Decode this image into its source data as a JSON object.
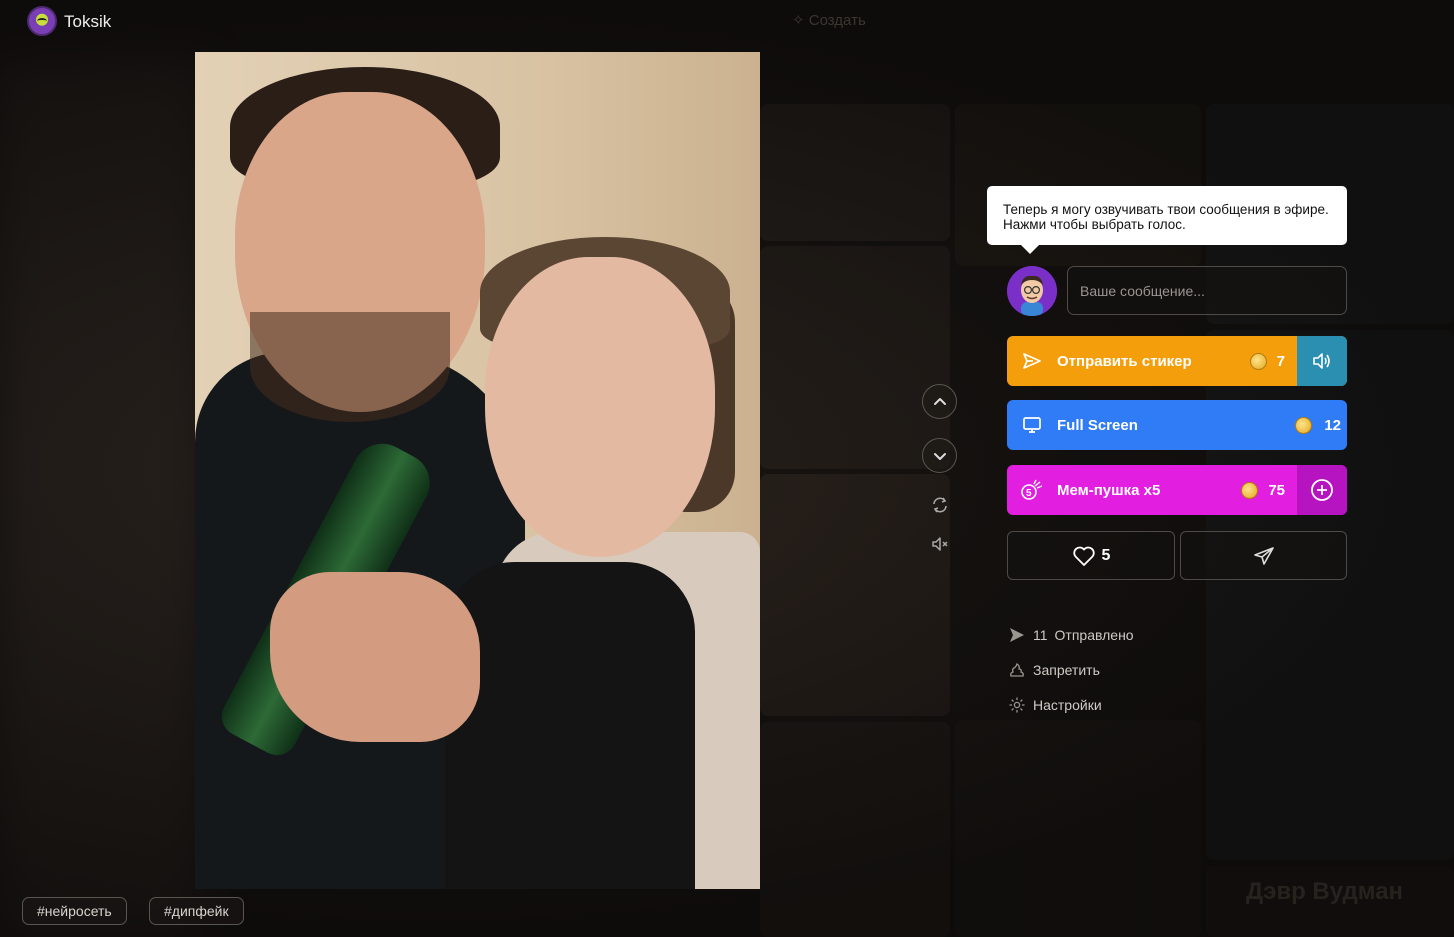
{
  "header": {
    "brand": "Toksik",
    "create_label": "Создать"
  },
  "video": {
    "tags": [
      "#нейросеть",
      "#дипфейк"
    ]
  },
  "panel": {
    "tooltip": "Теперь я могу озвучивать твои сообщения в эфире. Нажми чтобы выбрать голос.",
    "message_placeholder": "Ваше сообщение...",
    "actions": [
      {
        "label": "Отправить стикер",
        "price": "7",
        "color": "#f59e0b",
        "side_color": "#2a8fb0",
        "icon": "send-icon",
        "side_icon": "speaker-icon"
      },
      {
        "label": "Full Screen",
        "price": "12",
        "color": "#2f7cf6",
        "icon": "monitor-icon"
      },
      {
        "label": "Мем-пушка x5",
        "price": "75",
        "color": "#e21ee0",
        "side_color": "#b614c0",
        "icon": "meme-cannon-icon",
        "side_icon": "plus-circle-icon"
      }
    ],
    "likes": "5",
    "meta": {
      "sent_count": "11",
      "sent_label": "Отправлено",
      "ban_label": "Запретить",
      "settings_label": "Настройки"
    }
  },
  "background": {
    "ghost_name": "Дэвр Вудман"
  }
}
